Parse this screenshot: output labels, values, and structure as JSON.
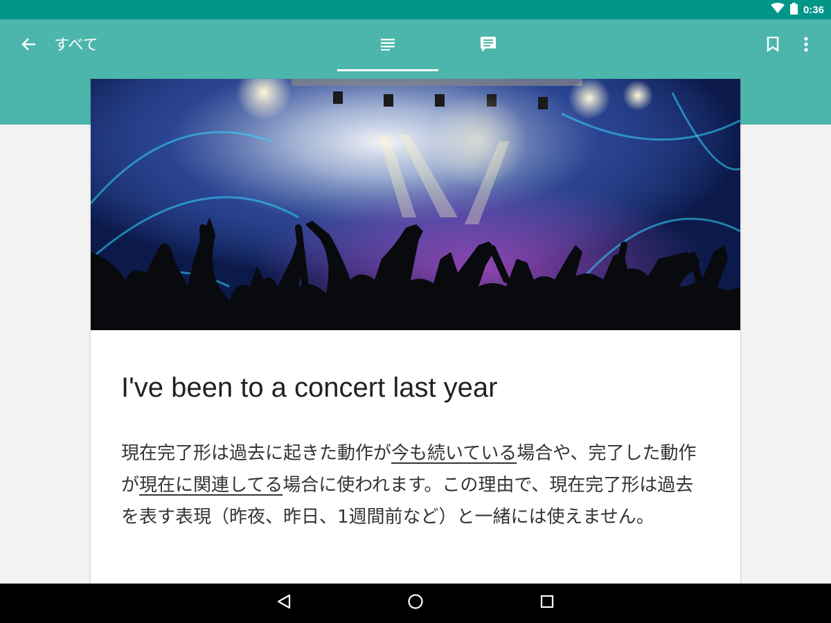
{
  "status_bar": {
    "time": "0:36",
    "icons": [
      "wifi-icon",
      "battery-icon"
    ]
  },
  "app_bar": {
    "back_icon": "arrow-back-icon",
    "title": "すべて",
    "tabs": [
      {
        "icon": "article-icon",
        "selected": true
      },
      {
        "icon": "comment-icon",
        "selected": false
      }
    ],
    "actions": [
      "bookmark-icon",
      "more-vert-icon"
    ]
  },
  "article": {
    "hero_image": "concert-crowd-stage-lights",
    "title": "I've been to a concert last year",
    "body": {
      "p1": "現在完了形は過去に起きた動作が",
      "u1": "今も続いている",
      "p2": "場合や、完了した動作が",
      "u2": "現在に関連してる",
      "p3": "場合に使われます。この理由で、現在完了形は過去を表す表現（昨夜、昨日、1週間前など）と一緒には使えません。"
    }
  },
  "nav_bar": {
    "buttons": [
      "back-triangle-icon",
      "home-circle-icon",
      "recents-square-icon"
    ]
  },
  "colors": {
    "status_bar": "#009688",
    "app_bar": "#4db6ac",
    "background": "#f3f3f3"
  }
}
